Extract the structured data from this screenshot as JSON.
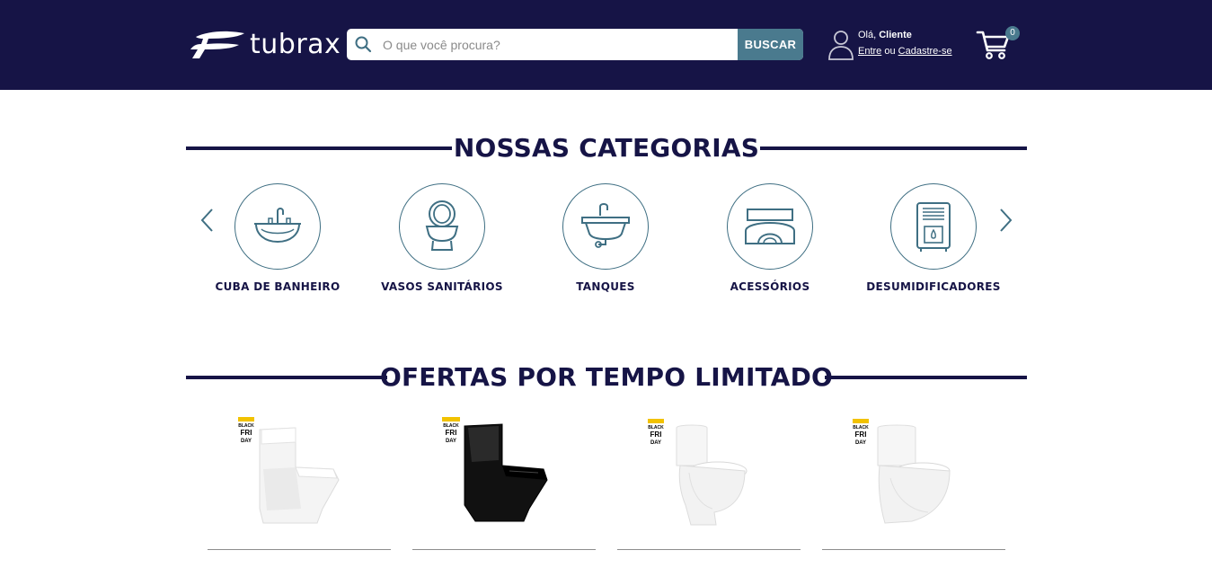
{
  "header": {
    "logo_text": "tubrax",
    "search_placeholder": "O que você procura?",
    "search_button": "BUSCAR",
    "greeting_prefix": "Olá, ",
    "greeting_name": "Cliente",
    "login_link": "Entre",
    "or_text": " ou ",
    "signup_link": "Cadastre-se",
    "cart_count": "0"
  },
  "categories": {
    "title": "NOSSAS CATEGORIAS",
    "items": [
      {
        "label": "CUBA DE BANHEIRO",
        "icon": "sink-icon"
      },
      {
        "label": "VASOS SANITÁRIOS",
        "icon": "toilet-icon"
      },
      {
        "label": "TANQUES",
        "icon": "laundry-tank-icon"
      },
      {
        "label": "ACESSÓRIOS",
        "icon": "accessories-icon"
      },
      {
        "label": "DESUMIDIFICADORES",
        "icon": "dehumidifier-icon"
      }
    ]
  },
  "offers": {
    "title": "OFERTAS POR TEMPO LIMITADO",
    "badge_text": [
      "BLACK",
      "FRI",
      "DAY"
    ],
    "products": [
      {
        "color": "#ffffff",
        "style": "white-square-toilet"
      },
      {
        "color": "#111111",
        "style": "black-square-toilet"
      },
      {
        "color": "#ffffff",
        "style": "white-round-toilet"
      },
      {
        "color": "#ffffff",
        "style": "white-round-toilet"
      }
    ]
  },
  "colors": {
    "header_bg": "#161446",
    "accent": "#4a7a8e",
    "title": "#161446"
  }
}
